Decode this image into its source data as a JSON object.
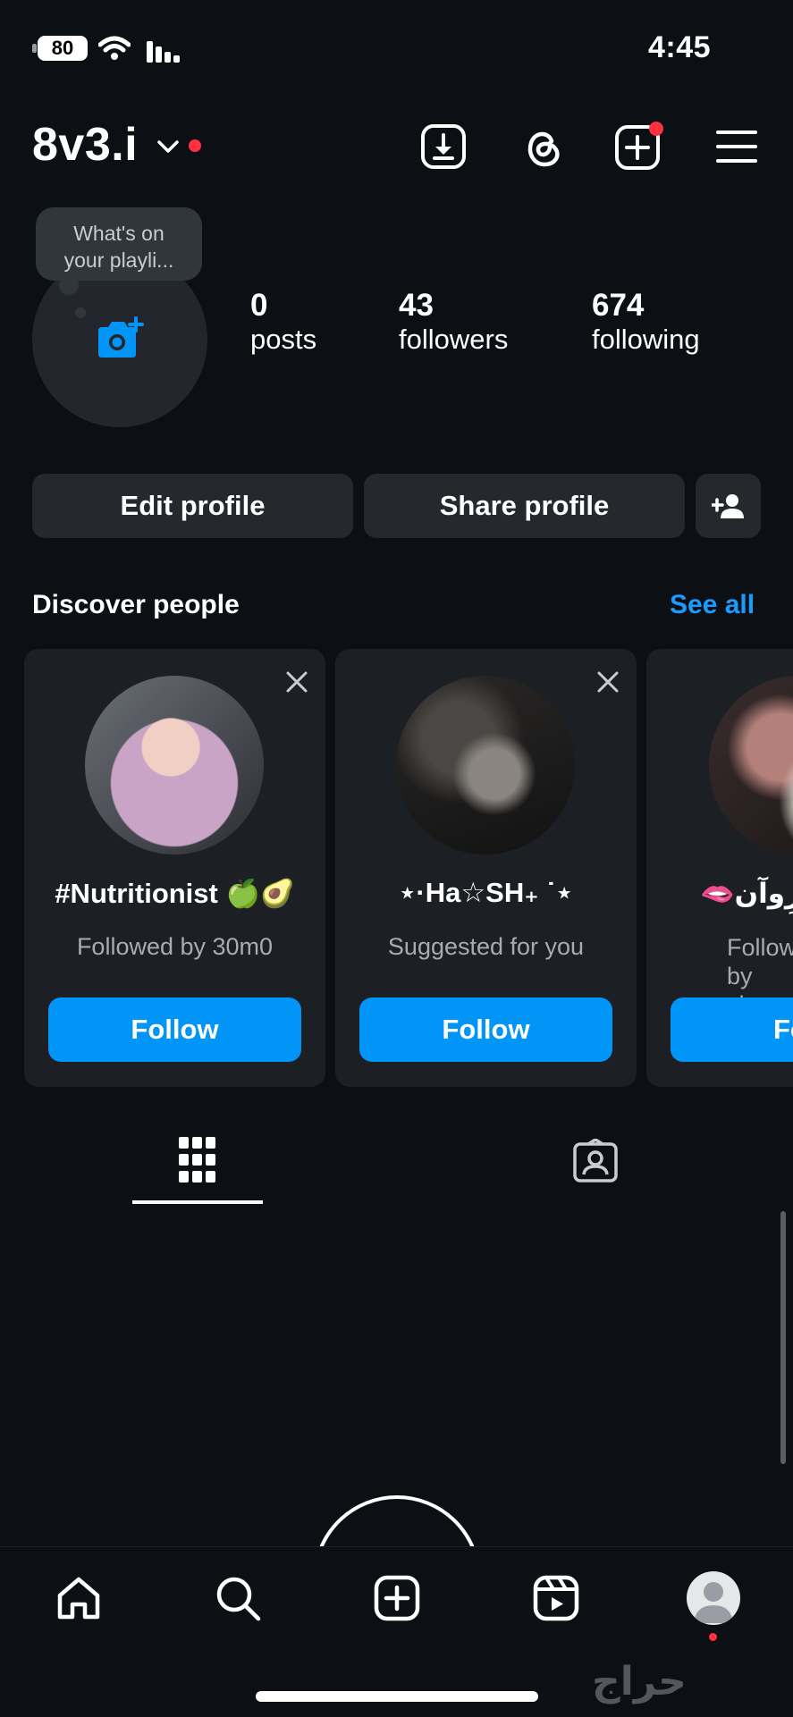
{
  "status_bar": {
    "time": "4:45",
    "battery": "80"
  },
  "header": {
    "username": "8v3.i"
  },
  "profile": {
    "note_bubble": "What's on\nyour playli...",
    "stats": [
      {
        "value": "0",
        "label": "posts"
      },
      {
        "value": "43",
        "label": "followers"
      },
      {
        "value": "674",
        "label": "following"
      }
    ]
  },
  "actions": {
    "edit": "Edit profile",
    "share": "Share profile"
  },
  "discover": {
    "title": "Discover people",
    "see_all": "See all",
    "cards": [
      {
        "name": "#Nutritionist 🍏🥑",
        "subtitle": "Followed by 30m0",
        "button": "Follow"
      },
      {
        "name": "⋆·Ha☆SH₊ ˙⋆",
        "subtitle": "Suggested for you",
        "button": "Follow"
      },
      {
        "name": "🫦ﺮِﻭﺁﻥ",
        "subtitle": "Followed by\nsharo",
        "button": "Follow"
      }
    ]
  },
  "watermark": "حراج",
  "colors": {
    "background": "#0c1014",
    "accent": "#0095f6",
    "link": "#1a9bff",
    "notification": "#ff3040"
  }
}
